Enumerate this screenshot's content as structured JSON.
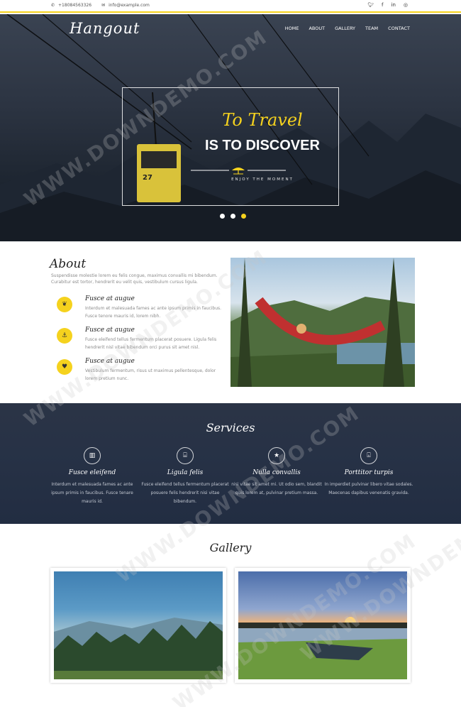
{
  "topbar": {
    "phone": "+18084563326",
    "email": "info@example.com",
    "social": [
      "twitter-icon",
      "facebook-icon",
      "linkedin-icon",
      "dribbble-icon"
    ]
  },
  "header": {
    "logo": "Hangout",
    "nav": [
      "HOME",
      "ABOUT",
      "GALLERY",
      "TEAM",
      "CONTACT"
    ]
  },
  "hero": {
    "title_line1": "To Travel",
    "title_line2": "IS TO DISCOVER",
    "subtitle": "ENJOY THE MOMENT",
    "slides": 3,
    "active_slide": 3,
    "cable_car_number": "27"
  },
  "about": {
    "title": "About",
    "lead": "Suspendisse molestie lorem eu felis congue, maximus convallis mi bibendum. Curabitur est tortor, hendrerit eu velit quis, vestibulum cursus ligula.",
    "features": [
      {
        "icon": "leaf-icon",
        "title": "Fusce at augue",
        "text": "Interdum et malesuada fames ac ante ipsum primis in faucibus. Fusce tenore mauris id, lorem nibh."
      },
      {
        "icon": "anchor-icon",
        "title": "Fusce at augue",
        "text": "Fusce eleifend tellus fermentum placerat posuere. Ligula felis hendrerit nisl vitae bibendum orci purus sit amet nisl."
      },
      {
        "icon": "heart-icon",
        "title": "Fusce at augue",
        "text": "Vestibulum fermentum, risus ut maximus pellentesque, dolor lorem pretium nunc."
      }
    ]
  },
  "services": {
    "title": "Services",
    "items": [
      {
        "icon": "building-icon",
        "title": "Fusce eleifend",
        "text": "Interdum et malesuada fames ac ante ipsum primis in faucibus. Fusce tenare mauris id."
      },
      {
        "icon": "bed-icon",
        "title": "Ligula felis",
        "text": "Fusce eleifend tellus fermentum placerat posuere felis hendrerit nisi vitae bibendum."
      },
      {
        "icon": "star-icon",
        "title": "Nulla convallis",
        "text": "nisi vitae sit amet mi. Ut odio sem, blandit quis lorem at, pulvinar pretium massa."
      },
      {
        "icon": "gift-icon",
        "title": "Porttitor turpis",
        "text": "In imperdiet pulvinar libero vitae sodales. Maecenas dapibus venenatis gravida."
      }
    ]
  },
  "gallery": {
    "title": "Gallery"
  },
  "watermark": "WWW.DOWNDEMO.COM",
  "colors": {
    "accent": "#f5d21e",
    "dark_section": "#252f42"
  }
}
